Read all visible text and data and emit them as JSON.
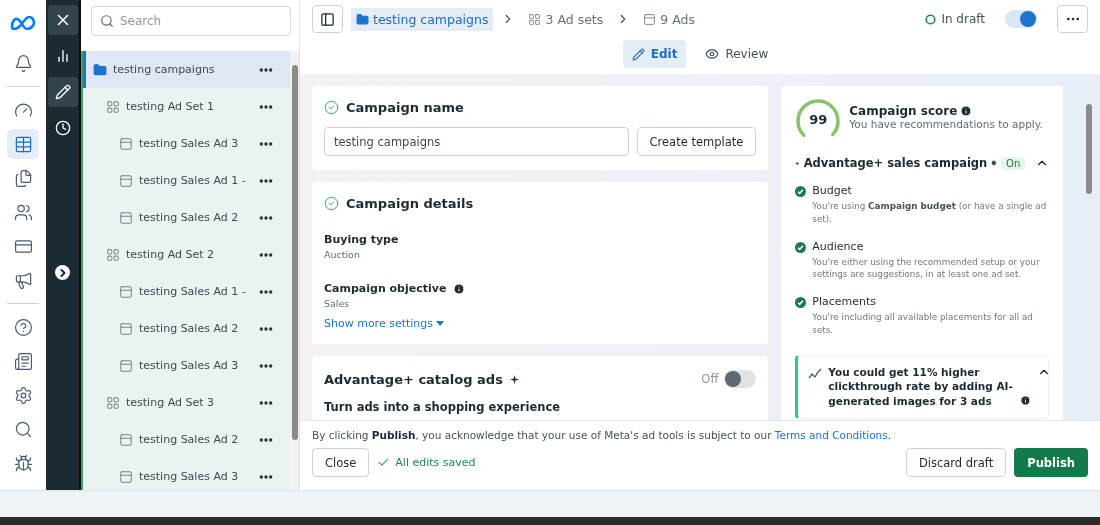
{
  "nav_rail": {
    "items": [
      {
        "selected": false
      },
      {
        "selected": false
      },
      {
        "selected": true
      },
      {
        "selected": false
      },
      {
        "selected": false
      },
      {
        "selected": false
      },
      {
        "selected": false
      },
      {
        "selected": false
      },
      {
        "selected": false
      },
      {
        "selected": false
      },
      {
        "selected": false
      },
      {
        "selected": false
      }
    ]
  },
  "tool_rail": {
    "items": [
      {
        "selected": false
      },
      {
        "selected": true
      },
      {
        "selected": false
      }
    ]
  },
  "tree": {
    "search": {
      "placeholder": "Search"
    },
    "nodes": [
      {
        "kind": "campaign",
        "label": "testing campaigns",
        "selected": true,
        "children": [
          {
            "kind": "ad_set",
            "label": "testing Ad Set 1",
            "selected": false,
            "children": [
              {
                "kind": "ad",
                "label": "testing Sales Ad 3",
                "selected": false
              },
              {
                "kind": "ad",
                "label": "testing Sales Ad 1 -",
                "selected": false
              },
              {
                "kind": "ad",
                "label": "testing Sales Ad 2",
                "selected": false
              }
            ]
          },
          {
            "kind": "ad_set",
            "label": "testing Ad Set 2",
            "selected": false,
            "children": [
              {
                "kind": "ad",
                "label": "testing Sales Ad 1 -",
                "selected": false
              },
              {
                "kind": "ad",
                "label": "testing Sales Ad 2",
                "selected": false
              },
              {
                "kind": "ad",
                "label": "testing Sales Ad 3",
                "selected": false
              }
            ]
          },
          {
            "kind": "ad_set",
            "label": "testing Ad Set 3",
            "selected": false,
            "children": [
              {
                "kind": "ad",
                "label": "testing Sales Ad 2",
                "selected": false
              },
              {
                "kind": "ad",
                "label": "testing Sales Ad 3",
                "selected": false
              }
            ]
          }
        ]
      }
    ]
  },
  "breadcrumb": [
    {
      "kind": "campaign",
      "label": "testing campaigns",
      "selected": true
    },
    {
      "kind": "ad_set",
      "label": "3 Ad sets",
      "selected": false
    },
    {
      "kind": "ad",
      "label": "9 Ads",
      "selected": false
    }
  ],
  "status": {
    "label": "In draft",
    "on": true
  },
  "modes": [
    {
      "kind": "edit",
      "label": "Edit",
      "selected": true
    },
    {
      "kind": "review",
      "label": "Review",
      "selected": false
    }
  ],
  "campaign_name": {
    "title": "Campaign name",
    "value": "testing campaigns",
    "button": "Create template"
  },
  "campaign_details": {
    "title": "Campaign details",
    "fields": [
      {
        "label": "Buying type",
        "value": "Auction",
        "info": false
      },
      {
        "label": "Campaign objective",
        "value": "Sales",
        "info": true
      }
    ],
    "link": "Show more settings"
  },
  "catalog_ads": {
    "title": "Advantage+ catalog ads",
    "switch_label": "Off",
    "on": false,
    "subtitle": "Turn ads into a shopping experience"
  },
  "score": {
    "value": "99",
    "level": 0.99,
    "title": "Campaign score",
    "subtitle": "You have recommendations to apply."
  },
  "advantage": {
    "title": "Advantage+ sales campaign",
    "badge": "On",
    "expanded": true,
    "checks": [
      {
        "title": "Budget",
        "text": "You're using **Campaign budget** (or have a single ad set)."
      },
      {
        "title": "Audience",
        "text": "You're either using the recommended setup or your settings are suggestions, in at least one ad set."
      },
      {
        "title": "Placements",
        "text": "You're including all available placements for all ad sets."
      }
    ]
  },
  "recommendation": {
    "text": "You could get 11% higher clickthrough rate by adding AI-generated images for 3 ads",
    "expanded": true
  },
  "footer": {
    "notice": "By clicking **Publish**, you acknowledge that your use of Meta's ad tools is subject to our",
    "link": "Terms and Conditions",
    "notice_end": ".",
    "close": "Close",
    "saved": "All edits saved",
    "discard": "Discard draft",
    "publish": "Publish"
  }
}
